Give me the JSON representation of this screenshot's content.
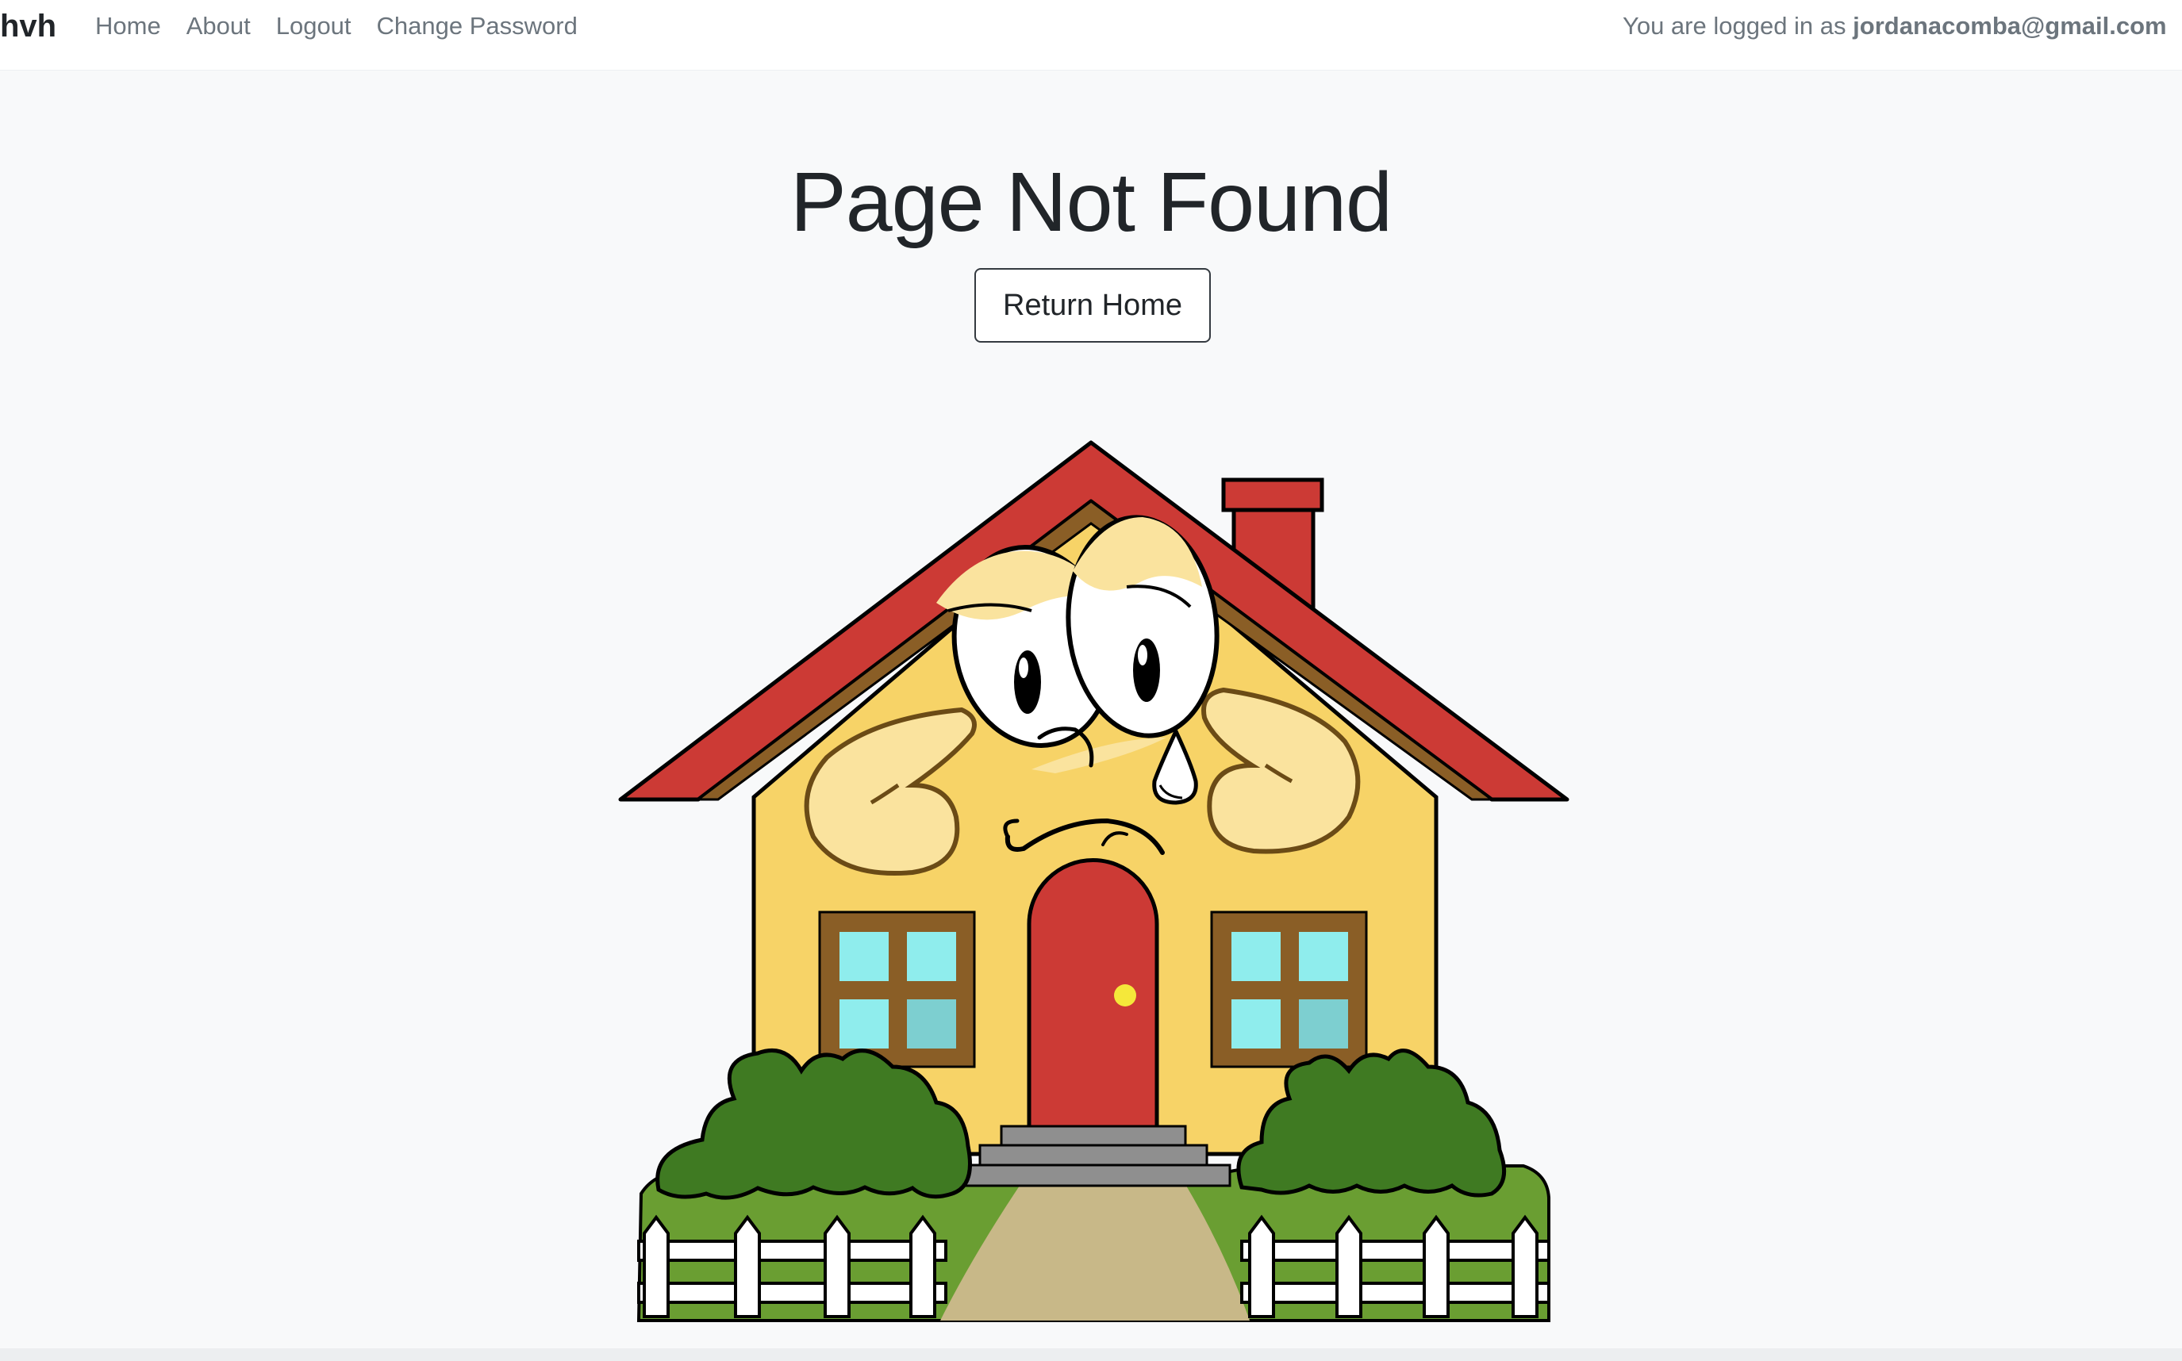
{
  "navbar": {
    "brand": "hvh",
    "links": [
      {
        "label": "Home"
      },
      {
        "label": "About"
      },
      {
        "label": "Logout"
      },
      {
        "label": "Change Password"
      }
    ],
    "login_prefix": "You are logged in as",
    "login_user": "jordanacomba@gmail.com"
  },
  "main": {
    "title": "Page Not Found",
    "return_button": "Return Home",
    "illustration": "sad-crying-house-illustration"
  },
  "colors": {
    "roof": "#cc3a35",
    "walls": "#f7d367",
    "trim": "#8a5e26",
    "door": "#cc3a35",
    "window_glass": "#8feded",
    "bushes": "#3f7a22",
    "lawn": "#6a9e32",
    "path": "#c8b888"
  }
}
